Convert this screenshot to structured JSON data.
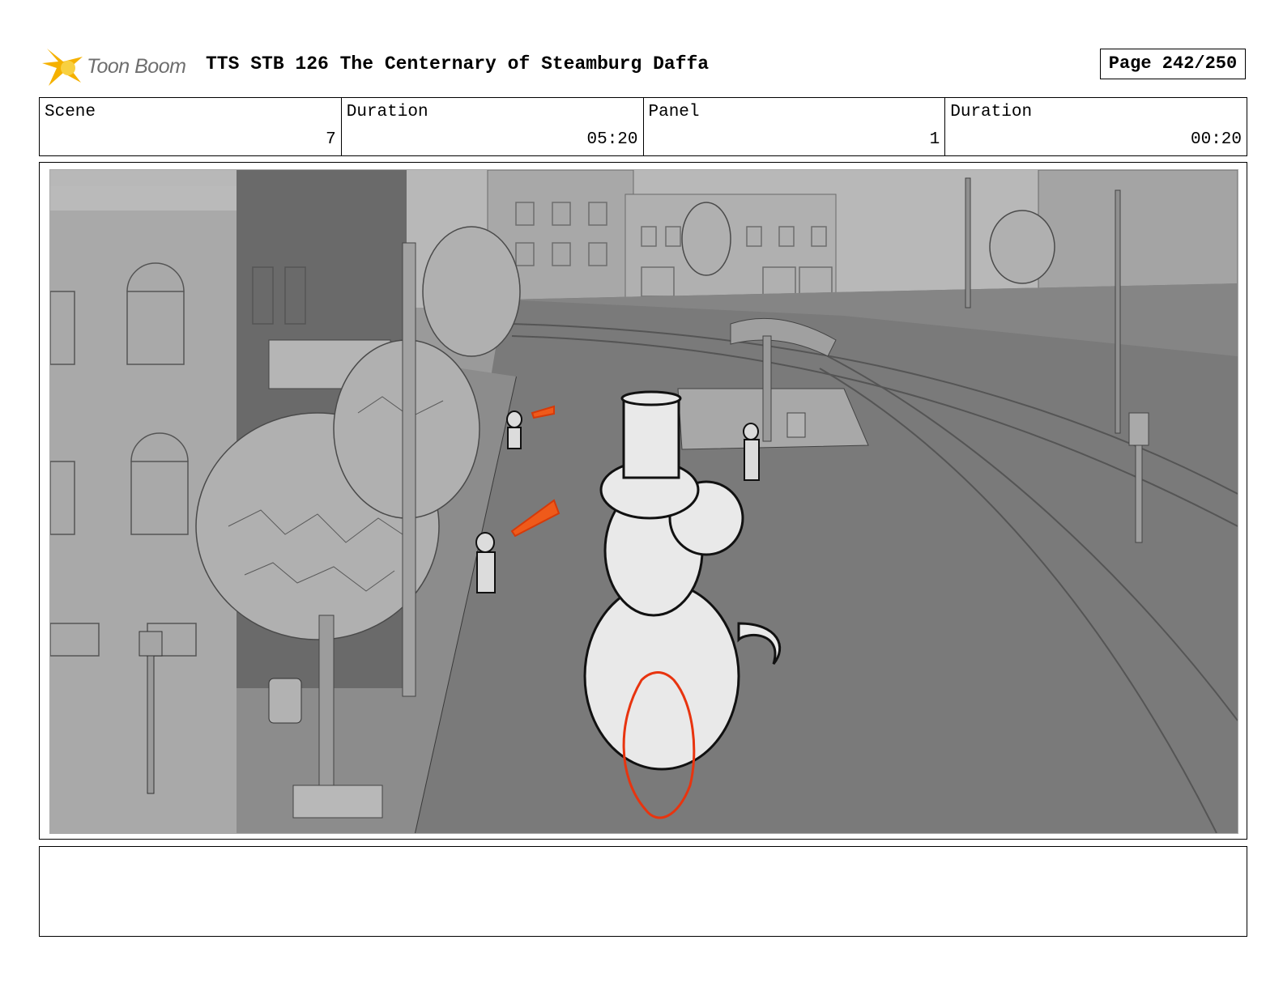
{
  "header": {
    "logo_text": "Toon Boom",
    "title": "TTS STB 126 The Centernary of Steamburg Daffa",
    "page": "Page 242/250"
  },
  "info": {
    "scene_label": "Scene",
    "scene_value": "7",
    "scene_duration_label": "Duration",
    "scene_duration_value": "05:20",
    "panel_label": "Panel",
    "panel_value": "1",
    "panel_duration_label": "Duration",
    "panel_duration_value": "00:20"
  },
  "panel": {
    "image_icon": "storyboard-street-scene",
    "colors": {
      "sketch_red": "#e8340f",
      "ground": "#7b7b7b",
      "sky": "#bdbdbd"
    }
  },
  "notes": {
    "text": ""
  }
}
